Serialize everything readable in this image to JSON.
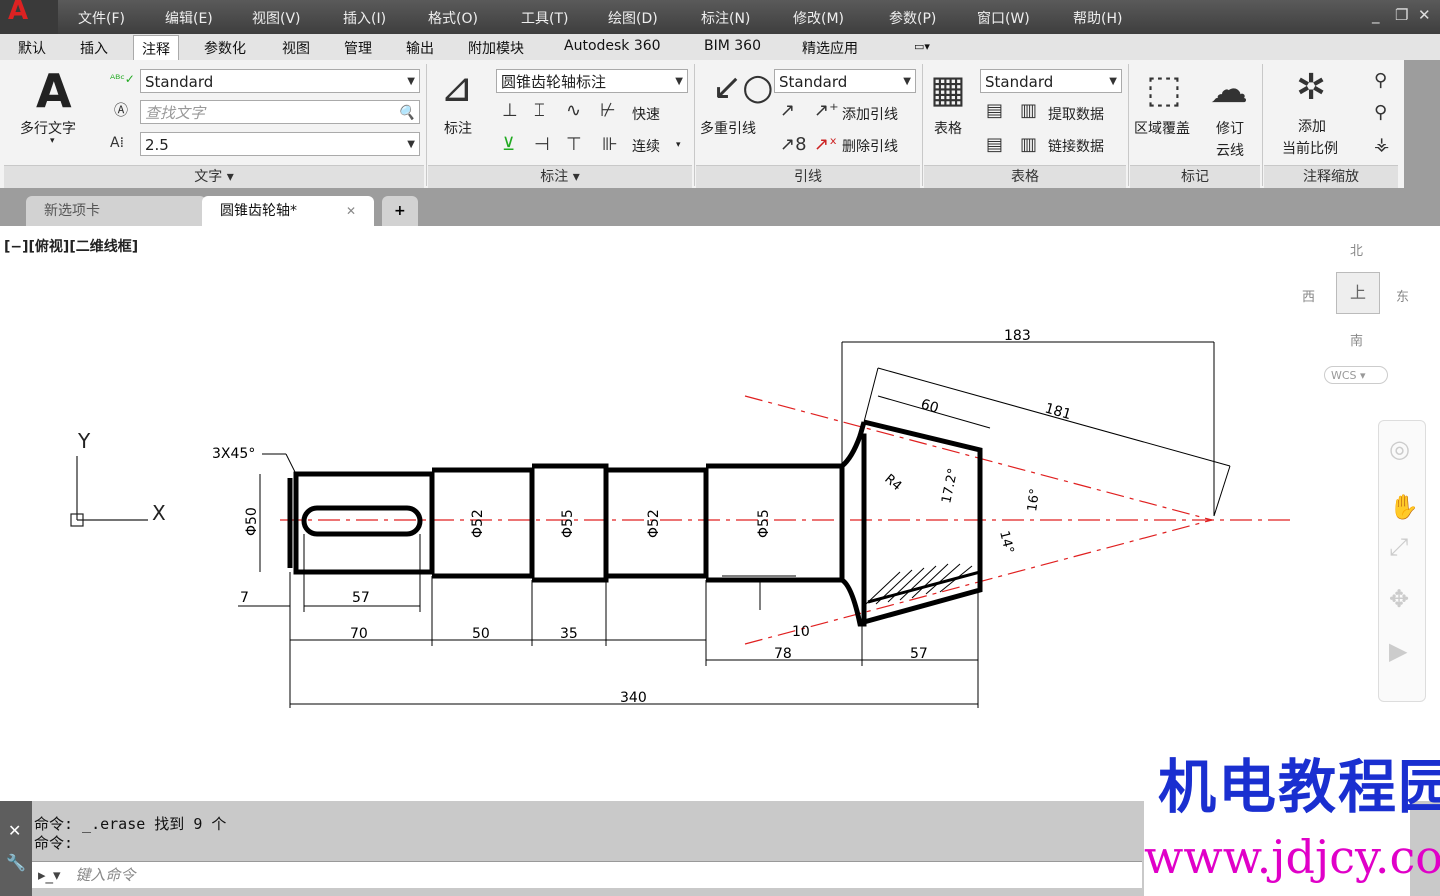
{
  "menu": [
    "文件(F)",
    "编辑(E)",
    "视图(V)",
    "插入(I)",
    "格式(O)",
    "工具(T)",
    "绘图(D)",
    "标注(N)",
    "修改(M)",
    "参数(P)",
    "窗口(W)",
    "帮助(H)"
  ],
  "window_controls": [
    "_",
    "❐",
    "✕"
  ],
  "ribbon_tabs": [
    "默认",
    "插入",
    "注释",
    "参数化",
    "视图",
    "管理",
    "输出",
    "附加模块",
    "Autodesk 360",
    "BIM 360",
    "精选应用"
  ],
  "active_tab": "注释",
  "text_panel": {
    "big_label": "多行文字",
    "style_value": "Standard",
    "find_placeholder": "查找文字",
    "height_value": "2.5",
    "title": "文字 ▾"
  },
  "dim_panel": {
    "big_label": "标注",
    "style_value": "圆锥齿轮轴标注",
    "quick": "快速",
    "continue": "连续",
    "title": "标注 ▾"
  },
  "leader_panel": {
    "big_label": "多重引线",
    "style_value": "Standard",
    "add": "添加引线",
    "remove": "删除引线",
    "title": "引线"
  },
  "table_panel": {
    "big_label": "表格",
    "style_value": "Standard",
    "extract": "提取数据",
    "link": "链接数据",
    "title": "表格"
  },
  "markup_panel": {
    "wipeout": "区域覆盖",
    "revcloud_1": "修订",
    "revcloud_2": "云线",
    "title": "标记"
  },
  "scale_panel": {
    "add_1": "添加",
    "add_2": "当前比例",
    "title": "注释缩放"
  },
  "doc_tabs": [
    "新选项卡",
    "圆锥齿轮轴*"
  ],
  "doc_tab_close": "✕",
  "doc_tab_add": "+",
  "view_label": "[−][俯视][二维线框]",
  "viewcube": {
    "n": "北",
    "s": "南",
    "e": "东",
    "w": "西",
    "top": "上",
    "wcs": "WCS"
  },
  "ucs": {
    "x": "X",
    "y": "Y"
  },
  "drawing": {
    "chamfer": "3X45°",
    "diameters": [
      "Φ50",
      "Φ52",
      "Φ55",
      "Φ52",
      "Φ55"
    ],
    "bottom_dims": [
      "7",
      "57",
      "70",
      "50",
      "35",
      "10",
      "78",
      "57",
      "340"
    ],
    "top_dims": [
      "183",
      "181",
      "60"
    ],
    "radius": "R4",
    "angles": [
      "17.2°",
      "16°",
      "14°"
    ]
  },
  "command": {
    "history_1": "命令: _.erase 找到 9 个",
    "history_2": "命令:",
    "prompt": "键入命令"
  },
  "watermark": {
    "line1": "机电教程园",
    "line2": "www.jdjcy.com"
  },
  "colors": {
    "accent_red": "#e02020",
    "watermark_blue": "#1a2fd0",
    "watermark_magenta": "#e000c8"
  }
}
